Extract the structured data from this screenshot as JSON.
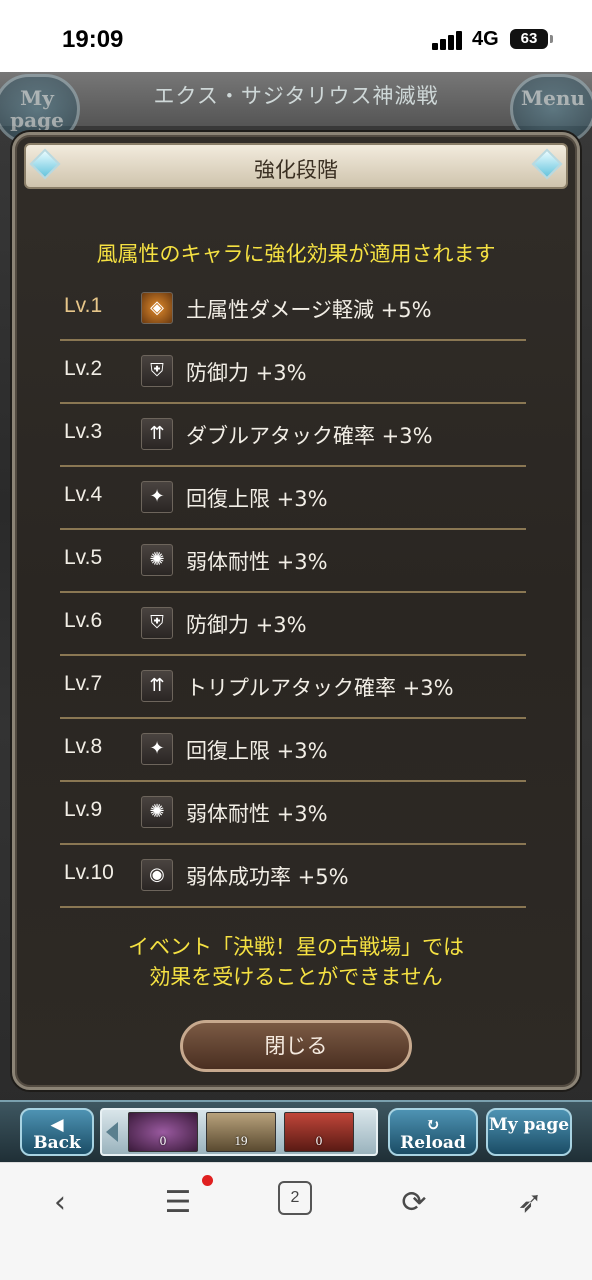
{
  "status_bar": {
    "time": "19:09",
    "network": "4G",
    "battery": "63"
  },
  "game": {
    "top_title": "エクス・サジタリウス神滅戦",
    "mypage_label": "My page",
    "menu_label": "Menu"
  },
  "modal": {
    "title": "強化段階",
    "subtitle": "風属性のキャラに強化効果が適用されます",
    "levels": [
      {
        "level": "Lv.1",
        "effect": "土属性ダメージ軽減 +5%",
        "icon": "earth-damage-reduction-icon"
      },
      {
        "level": "Lv.2",
        "effect": "防御力 +3%",
        "icon": "defense-up-icon"
      },
      {
        "level": "Lv.3",
        "effect": "ダブルアタック確率 +3%",
        "icon": "double-attack-icon"
      },
      {
        "level": "Lv.4",
        "effect": "回復上限 +3%",
        "icon": "heal-cap-icon"
      },
      {
        "level": "Lv.5",
        "effect": "弱体耐性 +3%",
        "icon": "debuff-resist-icon"
      },
      {
        "level": "Lv.6",
        "effect": "防御力 +3%",
        "icon": "defense-up-icon"
      },
      {
        "level": "Lv.7",
        "effect": "トリプルアタック確率 +3%",
        "icon": "triple-attack-icon"
      },
      {
        "level": "Lv.8",
        "effect": "回復上限 +3%",
        "icon": "heal-cap-icon"
      },
      {
        "level": "Lv.9",
        "effect": "弱体耐性 +3%",
        "icon": "debuff-resist-icon"
      },
      {
        "level": "Lv.10",
        "effect": "弱体成功率 +5%",
        "icon": "debuff-success-icon"
      }
    ],
    "notice_line1": "イベント「決戦！星の古戦場」では",
    "notice_line2": "効果を受けることができません",
    "close_label": "閉じる"
  },
  "game_bar": {
    "back_label": "Back",
    "reload_label": "Reload",
    "mypage_label": "My page",
    "items": [
      {
        "name": "purple-orb-item",
        "count": "0",
        "color": "#6b2f6e"
      },
      {
        "name": "ticket-item",
        "count": "19",
        "color": "#8a7a5a"
      },
      {
        "name": "red-box-item",
        "count": "0",
        "color": "#8c2a22"
      }
    ]
  },
  "browser_bar": {
    "tab_count": "2"
  }
}
